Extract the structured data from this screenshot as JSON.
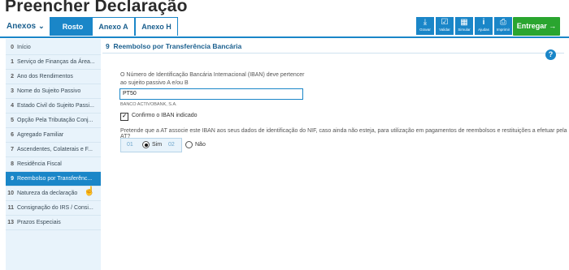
{
  "page_title": "Preencher Declaração",
  "tabbar": {
    "annexes_label": "Anexos",
    "tabs": [
      {
        "label": "Rosto",
        "active": true
      },
      {
        "label": "Anexo A",
        "active": false
      },
      {
        "label": "Anexo H",
        "active": false
      }
    ]
  },
  "toolbar": {
    "gravar": "Gravar",
    "validar": "Validar",
    "simular": "Simular",
    "ajudas": "Ajudas",
    "imprimir": "Imprimir",
    "entregar": "Entregar"
  },
  "sidebar": {
    "items": [
      {
        "num": "0",
        "label": "Início"
      },
      {
        "num": "1",
        "label": "Serviço de Finanças da Área..."
      },
      {
        "num": "2",
        "label": "Ano dos Rendimentos"
      },
      {
        "num": "3",
        "label": "Nome do Sujeito Passivo"
      },
      {
        "num": "4",
        "label": "Estado Civil do Sujeito Passi..."
      },
      {
        "num": "5",
        "label": "Opção Pela Tributação Conj..."
      },
      {
        "num": "6",
        "label": "Agregado Familiar"
      },
      {
        "num": "7",
        "label": "Ascendentes, Colaterais e F..."
      },
      {
        "num": "8",
        "label": "Residência Fiscal"
      },
      {
        "num": "9",
        "label": "Reembolso por Transferênc...",
        "active": true
      },
      {
        "num": "10",
        "label": "Natureza da declaração"
      },
      {
        "num": "11",
        "label": "Consignação do IRS / Consi..."
      },
      {
        "num": "13",
        "label": "Prazos Especiais"
      }
    ]
  },
  "section": {
    "number": "9",
    "title": "Reembolso por Transferência Bancária"
  },
  "iban": {
    "label": "O Número de Identificação Bancária Internacional (IBAN) deve pertencer ao sujeito passivo A e/ou B",
    "value": "PT50",
    "bank_name": "BANCO ACTIVOBANK, S.A.",
    "confirm_label": "Confirmo o IBAN indicado",
    "confirmed": true
  },
  "question": {
    "text": "Pretende que a AT associe este IBAN aos seus dados de identificação do NIF, caso ainda não esteja, para utilização em pagamentos de reembolsos e restituições a efetuar pela AT?",
    "code_yes": "01",
    "label_yes": "Sim",
    "code_no": "02",
    "label_no": "Não",
    "selected": "Sim"
  },
  "colors": {
    "primary": "#1a86c8",
    "enter": "#2aa52f",
    "sidebar_bg": "#e8f3fb"
  }
}
